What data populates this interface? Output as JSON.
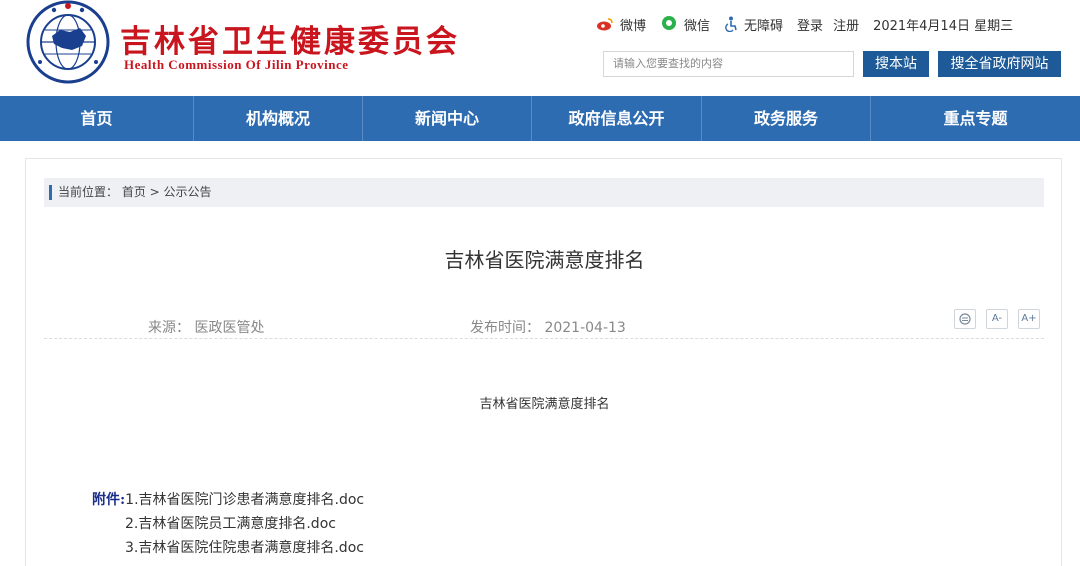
{
  "header": {
    "title": "吉林省卫生健康委员会",
    "subtitle": "Health Commission Of Jilin Province",
    "emblem_icon": "jilin-health-emblem-icon"
  },
  "top_links": {
    "weibo": "微博",
    "weixin": "微信",
    "accessibility": "无障碍",
    "login": "登录",
    "register": "注册",
    "date": "2021年4月14日 星期三"
  },
  "search": {
    "placeholder": "请输入您要查找的内容",
    "site_button": "搜本站",
    "gov_button": "搜全省政府网站"
  },
  "nav": {
    "items": [
      {
        "label": "首页"
      },
      {
        "label": "机构概况"
      },
      {
        "label": "新闻中心"
      },
      {
        "label": "政府信息公开"
      },
      {
        "label": "政务服务"
      },
      {
        "label": "重点专题"
      }
    ]
  },
  "breadcrumb": {
    "text": "当前位置：  首页 > 公示公告"
  },
  "article": {
    "title": "吉林省医院满意度排名",
    "source": "来源：  医政医管处",
    "publish": "发布时间：  2021-04-13",
    "tools": {
      "print": "print-icon",
      "font_minus": "A-",
      "font_plus": "A+"
    },
    "body_text": "吉林省医院满意度排名",
    "attachments_label": "附件:",
    "attachments": [
      "1.吉林省医院门诊患者满意度排名.doc",
      "2.吉林省医院员工满意度排名.doc",
      "3.吉林省医院住院患者满意度排名.doc"
    ]
  },
  "colors": {
    "brand_red": "#c9151e",
    "nav_blue": "#2e6cb2",
    "button_blue": "#1e5a97",
    "attach_label": "#1a2e8a"
  }
}
